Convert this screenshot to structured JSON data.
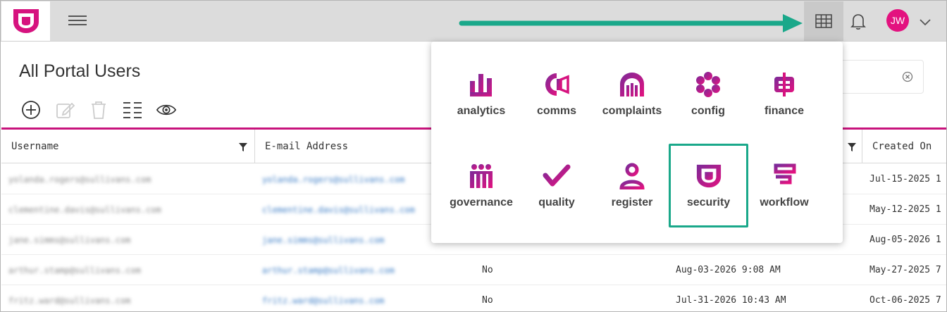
{
  "colors": {
    "brand": "#d6137f",
    "brand_purple": "#7b2a99",
    "highlight": "#1aa88a",
    "header_rule": "#c8137c"
  },
  "header": {
    "logo_icon": "shield-logo-icon",
    "menu_icon": "hamburger-icon",
    "apps_icon": "app-grid-icon",
    "notifications_icon": "bell-icon",
    "user_initials": "JW",
    "user_menu_icon": "chevron-down-icon"
  },
  "page": {
    "title": "All Portal Users"
  },
  "toolbar": {
    "icons": [
      "add-icon",
      "edit-icon",
      "delete-icon",
      "columns-icon",
      "view-icon"
    ]
  },
  "search": {
    "clear_icon": "clear-circle-icon"
  },
  "table": {
    "columns": [
      "Username",
      "E-mail Address",
      "",
      "",
      "Created On"
    ],
    "rows": [
      {
        "username": "yolanda.rogers@sullivans.com",
        "email": "yolanda.rogers@sullivans.com",
        "flag": "",
        "date": "",
        "created": "Jul-15-2025 1"
      },
      {
        "username": "clementine.davis@sullivans.com",
        "email": "clementine.davis@sullivans.com",
        "flag": "",
        "date": "",
        "created": "May-12-2025 1"
      },
      {
        "username": "jane.simms@sullivans.com",
        "email": "jane.simms@sullivans.com",
        "flag": "",
        "date": "",
        "created": "Aug-05-2026 1"
      },
      {
        "username": "arthur.stamp@sullivans.com",
        "email": "arthur.stamp@sullivans.com",
        "flag": "No",
        "date": "Aug-03-2026 9:08 AM",
        "created": "May-27-2025 7"
      },
      {
        "username": "fritz.ward@sullivans.com",
        "email": "fritz.ward@sullivans.com",
        "flag": "No",
        "date": "Jul-31-2026 10:43 AM",
        "created": "Oct-06-2025 7"
      }
    ]
  },
  "app_menu": {
    "items": [
      {
        "label": "analytics",
        "icon": "analytics-icon"
      },
      {
        "label": "comms",
        "icon": "comms-icon"
      },
      {
        "label": "complaints",
        "icon": "complaints-icon"
      },
      {
        "label": "config",
        "icon": "config-icon"
      },
      {
        "label": "finance",
        "icon": "finance-icon"
      },
      {
        "label": "governance",
        "icon": "governance-icon"
      },
      {
        "label": "quality",
        "icon": "quality-icon"
      },
      {
        "label": "register",
        "icon": "register-icon"
      },
      {
        "label": "security",
        "icon": "security-icon",
        "selected": true
      },
      {
        "label": "workflow",
        "icon": "workflow-icon"
      }
    ]
  }
}
